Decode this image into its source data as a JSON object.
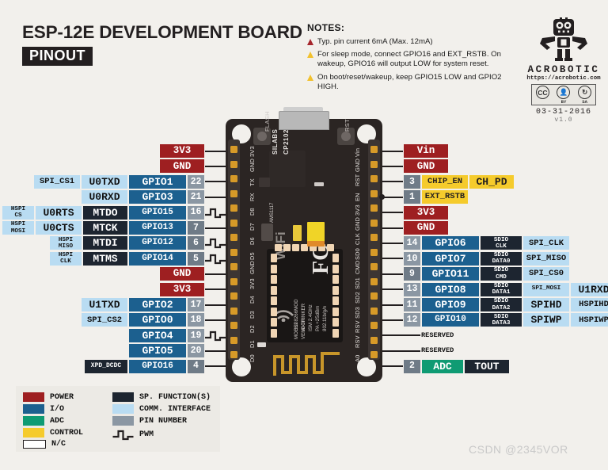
{
  "title": {
    "main": "ESP-12E DEVELOPMENT BOARD",
    "badge": "PINOUT"
  },
  "notes": {
    "heading": "NOTES:",
    "items": [
      {
        "marker": "red",
        "text": "Typ. pin current 6mA (Max. 12mA)"
      },
      {
        "marker": "yellow",
        "text": "For sleep mode, connect GPIO16 and EXT_RSTB. On wakeup, GPIO16 will output LOW for system reset."
      },
      {
        "marker": "yellow",
        "text": "On boot/reset/wakeup, keep GPIO15 LOW and GPIO2 HIGH."
      }
    ]
  },
  "logo": {
    "wordmark": "ACROBOTIC",
    "url": "https://acrobotic.com",
    "cc": {
      "cc": "CC",
      "by_icon": "BY",
      "sa_icon": "SA"
    },
    "date": "03-31-2016",
    "version": "v1.0"
  },
  "left_pins": [
    {
      "num": "",
      "pwm": false,
      "cells": [
        {
          "t": "3V3",
          "c": "power"
        }
      ]
    },
    {
      "num": "",
      "pwm": false,
      "cells": [
        {
          "t": "GND",
          "c": "power"
        }
      ]
    },
    {
      "num": "22",
      "pwm": false,
      "cells": [
        {
          "t": "SPI_CS1",
          "c": "comm-sm"
        },
        {
          "t": "U0TXD",
          "c": "comm"
        },
        {
          "t": "GPIO1",
          "c": "io"
        }
      ]
    },
    {
      "num": "21",
      "pwm": false,
      "cells": [
        {
          "t": "U0RXD",
          "c": "comm"
        },
        {
          "t": "GPIO3",
          "c": "io"
        }
      ]
    },
    {
      "num": "16",
      "pwm": true,
      "cells": [
        {
          "t": "HSPI\nCS",
          "c": "comm-xs"
        },
        {
          "t": "U0RTS",
          "c": "comm"
        },
        {
          "t": "MTDO",
          "c": "spf"
        },
        {
          "t": "GPIO15",
          "c": "io-sm"
        }
      ]
    },
    {
      "num": "7",
      "pwm": false,
      "cells": [
        {
          "t": "HSPI\nMOSI",
          "c": "comm-xs"
        },
        {
          "t": "U0CTS",
          "c": "comm"
        },
        {
          "t": "MTCK",
          "c": "spf"
        },
        {
          "t": "GPIO13",
          "c": "io-sm"
        }
      ]
    },
    {
      "num": "6",
      "pwm": true,
      "cells": [
        {
          "t": "HSPI\nMISO",
          "c": "comm-xs"
        },
        {
          "t": "MTDI",
          "c": "spf"
        },
        {
          "t": "GPIO12",
          "c": "io-sm"
        }
      ]
    },
    {
      "num": "5",
      "pwm": true,
      "cells": [
        {
          "t": "HSPI\nCLK",
          "c": "comm-xs"
        },
        {
          "t": "MTMS",
          "c": "spf"
        },
        {
          "t": "GPIO14",
          "c": "io-sm"
        }
      ]
    },
    {
      "num": "",
      "pwm": false,
      "cells": [
        {
          "t": "GND",
          "c": "power"
        }
      ]
    },
    {
      "num": "",
      "pwm": false,
      "cells": [
        {
          "t": "3V3",
          "c": "power"
        }
      ]
    },
    {
      "num": "17",
      "pwm": false,
      "cells": [
        {
          "t": "U1TXD",
          "c": "comm"
        },
        {
          "t": "GPIO2",
          "c": "io"
        }
      ]
    },
    {
      "num": "18",
      "pwm": false,
      "cells": [
        {
          "t": "SPI_CS2",
          "c": "comm-sm"
        },
        {
          "t": "GPIO0",
          "c": "io"
        }
      ]
    },
    {
      "num": "19",
      "pwm": true,
      "cells": [
        {
          "t": "GPIO4",
          "c": "io"
        }
      ]
    },
    {
      "num": "20",
      "pwm": false,
      "cells": [
        {
          "t": "GPIO5",
          "c": "io"
        }
      ]
    },
    {
      "num": "4",
      "pwm": false,
      "cells": [
        {
          "t": "XPD_DCDC",
          "c": "spf-sm"
        },
        {
          "t": "GPIO16",
          "c": "io-sm"
        }
      ]
    }
  ],
  "right_pins": [
    {
      "num": "",
      "dot": false,
      "cells": [
        {
          "t": "Vin",
          "c": "power"
        }
      ]
    },
    {
      "num": "",
      "dot": false,
      "cells": [
        {
          "t": "GND",
          "c": "power"
        }
      ]
    },
    {
      "num": "3",
      "dot": false,
      "cells": [
        {
          "t": "CHIP_EN",
          "c": "ctrl"
        },
        {
          "t": "CH_PD",
          "c": "ctrl-lg"
        }
      ]
    },
    {
      "num": "1",
      "dot": true,
      "cells": [
        {
          "t": "EXT_RSTB",
          "c": "ctrl"
        }
      ]
    },
    {
      "num": "",
      "dot": false,
      "cells": [
        {
          "t": "3V3",
          "c": "power"
        }
      ]
    },
    {
      "num": "",
      "dot": false,
      "cells": [
        {
          "t": "GND",
          "c": "power"
        }
      ]
    },
    {
      "num": "14",
      "dot": false,
      "cells": [
        {
          "t": "GPIO6",
          "c": "io"
        },
        {
          "t": "SDIO\nCLK",
          "c": "spf-two"
        },
        {
          "t": "SPI_CLK",
          "c": "comm-sm"
        }
      ]
    },
    {
      "num": "10",
      "dot": false,
      "cells": [
        {
          "t": "GPIO7",
          "c": "io"
        },
        {
          "t": "SDIO\nDATA0",
          "c": "spf-two"
        },
        {
          "t": "SPI_MISO",
          "c": "comm-sm"
        }
      ]
    },
    {
      "num": "9",
      "dot": false,
      "cells": [
        {
          "t": "GPIO11",
          "c": "io"
        },
        {
          "t": "SDIO\nCMD",
          "c": "spf-two"
        },
        {
          "t": "SPI_CS0",
          "c": "comm-sm"
        }
      ]
    },
    {
      "num": "13",
      "dot": false,
      "cells": [
        {
          "t": "GPIO8",
          "c": "io"
        },
        {
          "t": "SDIO\nDATA1",
          "c": "spf-two"
        },
        {
          "t": "SPI_MOSI",
          "c": "comm-xs2"
        },
        {
          "t": "U1RXD",
          "c": "comm"
        }
      ]
    },
    {
      "num": "11",
      "dot": false,
      "cells": [
        {
          "t": "GPIO9",
          "c": "io"
        },
        {
          "t": "SDIO\nDATA2",
          "c": "spf-two"
        },
        {
          "t": "SPIHD",
          "c": "comm"
        },
        {
          "t": "HSPIHD",
          "c": "comm-sm"
        }
      ]
    },
    {
      "num": "12",
      "dot": false,
      "cells": [
        {
          "t": "GPIO10",
          "c": "io-sm"
        },
        {
          "t": "SDIO\nDATA3",
          "c": "spf-two"
        },
        {
          "t": "SPIWP",
          "c": "comm"
        },
        {
          "t": "HSPIWP",
          "c": "comm-sm"
        }
      ]
    },
    {
      "num": "",
      "dot": false,
      "cells": [
        {
          "t": "RESERVED",
          "c": "nc"
        }
      ]
    },
    {
      "num": "",
      "dot": false,
      "cells": [
        {
          "t": "RESERVED",
          "c": "nc"
        }
      ]
    },
    {
      "num": "2",
      "dot": false,
      "cells": [
        {
          "t": "ADC",
          "c": "adc"
        },
        {
          "t": "TOUT",
          "c": "spf"
        }
      ]
    }
  ],
  "board": {
    "silk_left": [
      "3V3",
      "GND",
      "TX",
      "RX",
      "D8",
      "D7",
      "D6",
      "D5",
      "GND",
      "3V3",
      "D4",
      "D3",
      "D2",
      "D1",
      "D0"
    ],
    "silk_right": [
      "Vin",
      "GND",
      "RST",
      "EN",
      "3V3",
      "GND",
      "CLK",
      "SD0",
      "CMD",
      "SD1",
      "SD2",
      "SD3",
      "RSV",
      "RSV",
      "A0"
    ],
    "flash_button": "FLASH",
    "rst_button": "RST",
    "usb_chip_line1": "SILABS",
    "usb_chip_line2": "CP2102",
    "regulator": "AMS1117",
    "module": {
      "wifi": "WiFi",
      "fcc": "FC",
      "lines": [
        "ESP8266MOD",
        "AI-THINKER",
        "ISM 2.4GHz",
        "PA +25dBm",
        "802.11b/g/n"
      ],
      "model": "MODEL",
      "vendor": "VENDOR"
    }
  },
  "legend": {
    "col1": [
      {
        "label": "POWER",
        "color": "#9e1f21"
      },
      {
        "label": "I/O",
        "color": "#1c608f"
      },
      {
        "label": "ADC",
        "color": "#0f9b73"
      },
      {
        "label": "CONTROL",
        "color": "#f5cb2c"
      },
      {
        "label": "N/C",
        "color": "#ffffff"
      }
    ],
    "col2": [
      {
        "label": "SP. FUNCTION(S)",
        "color": "#1d2530"
      },
      {
        "label": "COMM. INTERFACE",
        "color": "#b9dcf2"
      },
      {
        "label": "PIN NUMBER",
        "color": "#8b97a3"
      },
      {
        "label": "PWM",
        "color": "pwm-glyph"
      }
    ]
  },
  "watermark": "CSDN @2345VOR"
}
